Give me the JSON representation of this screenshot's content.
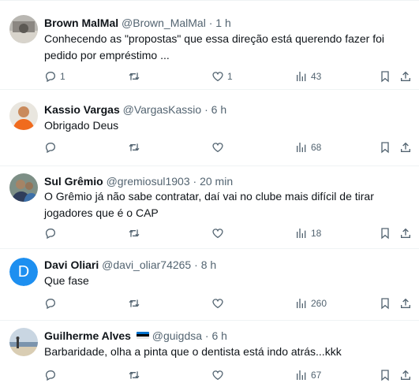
{
  "tweets": [
    {
      "name": "Brown MalMal",
      "handle": "@Brown_MalMal",
      "separator": "·",
      "time": "1 h",
      "text": "Conhecendo as \"propostas\" que essa direção está querendo fazer foi pedido por empréstimo ...",
      "replies": "1",
      "retweets": "",
      "likes": "1",
      "views": "43"
    },
    {
      "name": "Kassio Vargas",
      "handle": "@VargasKassio",
      "separator": "·",
      "time": "6 h",
      "text": "Obrigado Deus",
      "replies": "",
      "retweets": "",
      "likes": "",
      "views": "68"
    },
    {
      "name": "Sul Grêmio",
      "handle": "@gremiosul1903",
      "separator": "·",
      "time": "20 min",
      "text": "O Grêmio já não sabe contratar, daí vai no clube mais difícil de tirar jogadores que é o CAP",
      "replies": "",
      "retweets": "",
      "likes": "",
      "views": "18"
    },
    {
      "name": "Davi Oliari",
      "handle": "@davi_oliar74265",
      "separator": "·",
      "time": "8 h",
      "text": "Que fase",
      "avatar_letter": "D",
      "replies": "",
      "retweets": "",
      "likes": "",
      "views": "260"
    },
    {
      "name": "Guilherme Alves",
      "handle": "@guigdsa",
      "separator": "·",
      "time": "6 h",
      "text": "Barbaridade, olha a pinta que o dentista está indo atrás...kkk",
      "replies": "",
      "retweets": "",
      "likes": "",
      "views": "67"
    }
  ],
  "colors": {
    "text": "#0f1419",
    "secondary": "#536471",
    "divider": "#eff3f4",
    "avatar_blue": "#1d8ff0"
  },
  "icons": [
    "reply-icon",
    "retweet-icon",
    "like-icon",
    "views-icon",
    "bookmark-icon",
    "share-icon"
  ]
}
